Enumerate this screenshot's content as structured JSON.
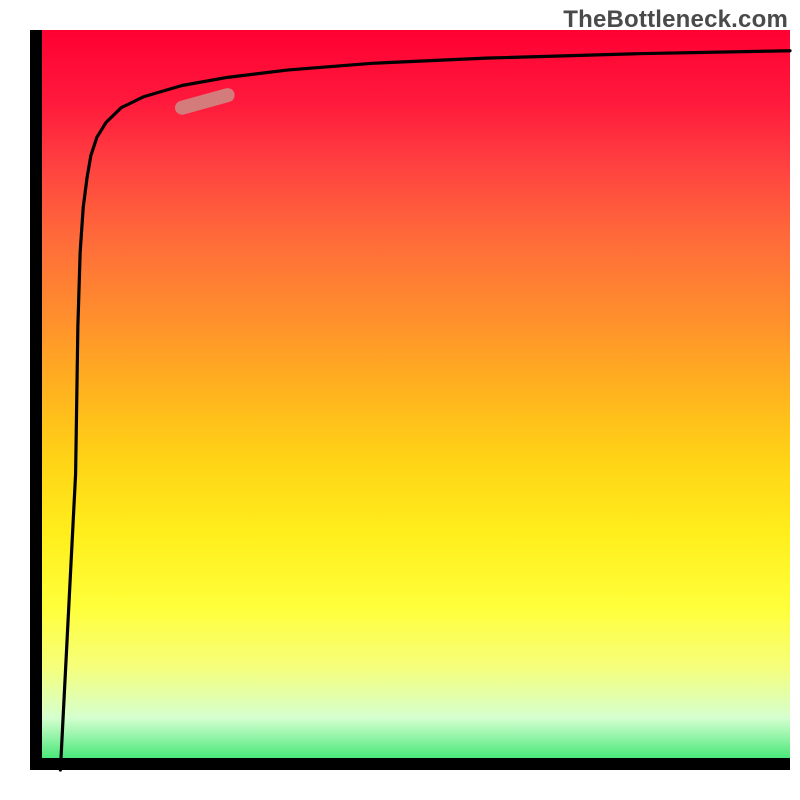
{
  "watermark": "TheBottleneck.com",
  "colors": {
    "curve": "#000000",
    "highlight": "#cd8d87",
    "frame": "#000000"
  },
  "chart_data": {
    "type": "line",
    "title": "",
    "xlabel": "",
    "ylabel": "",
    "xlim": [
      0,
      100
    ],
    "ylim": [
      0,
      100
    ],
    "grid": false,
    "series": [
      {
        "name": "curve",
        "x": [
          4,
          6,
          6.3,
          6.6,
          7.0,
          7.5,
          8.0,
          8.8,
          10.0,
          12.0,
          15.0,
          20.0,
          26.0,
          34.0,
          45.0,
          60.0,
          80.0,
          100.0
        ],
        "values": [
          0,
          40,
          60,
          70,
          76,
          80,
          83,
          85.5,
          87.5,
          89.5,
          91.0,
          92.5,
          93.6,
          94.6,
          95.5,
          96.2,
          96.8,
          97.2
        ]
      }
    ],
    "highlight_segment": {
      "x": [
        20.0,
        26.0
      ],
      "values": [
        89.5,
        91.2
      ]
    },
    "legend": false
  }
}
